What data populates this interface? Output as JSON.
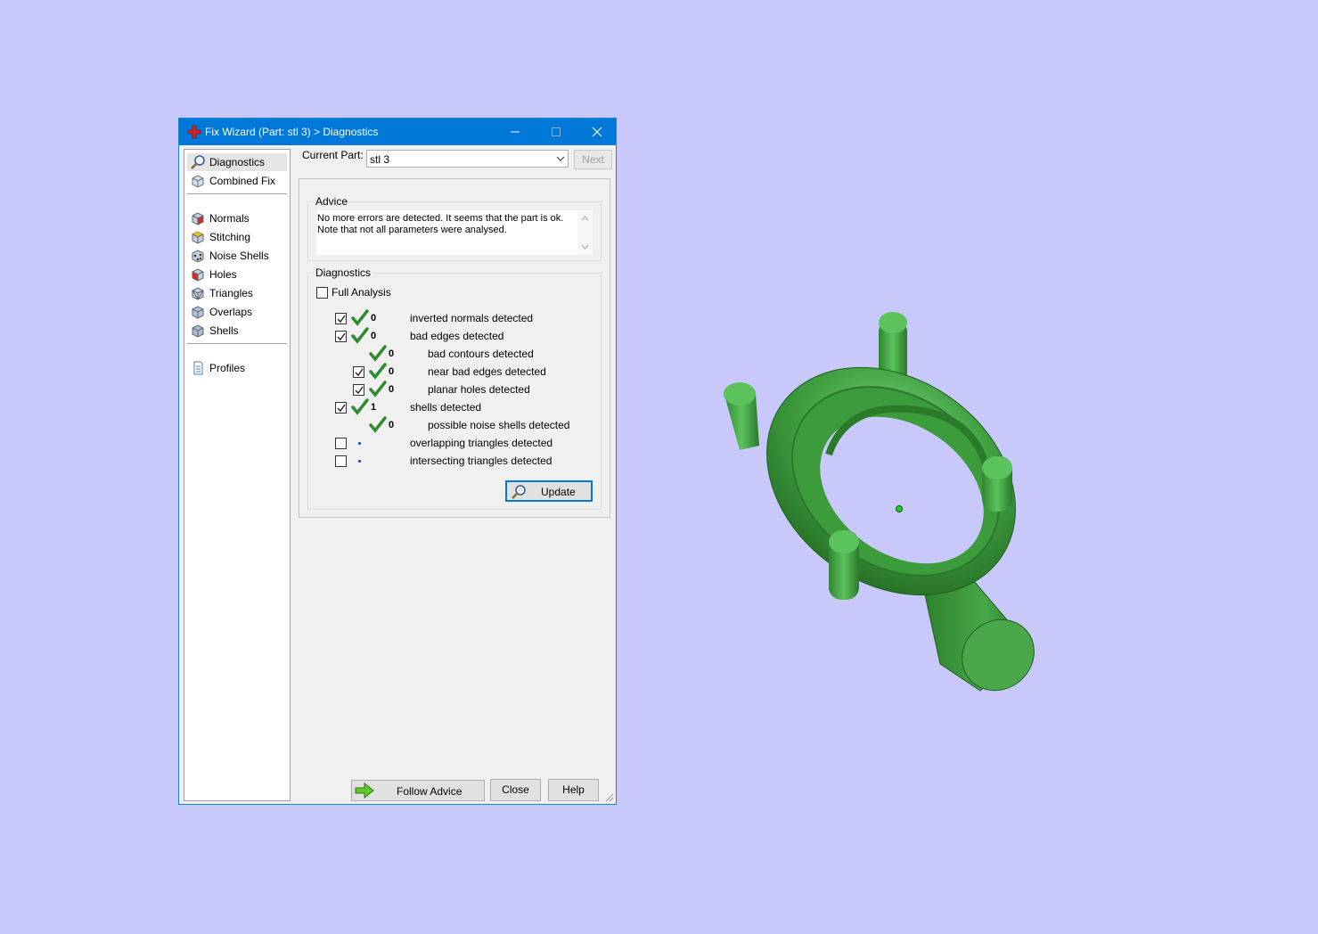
{
  "window": {
    "title": "Fix Wizard (Part: stl 3) > Diagnostics",
    "titlebar_color": "#0078d7"
  },
  "sidebar": {
    "items": [
      {
        "label": "Diagnostics",
        "icon": "magnifier-icon",
        "selected": true
      },
      {
        "label": "Combined Fix",
        "icon": "combined-fix-icon"
      },
      {
        "label": "Normals",
        "icon": "normals-cube-icon"
      },
      {
        "label": "Stitching",
        "icon": "stitching-cube-icon"
      },
      {
        "label": "Noise Shells",
        "icon": "noise-shells-icon"
      },
      {
        "label": "Holes",
        "icon": "holes-cube-icon"
      },
      {
        "label": "Triangles",
        "icon": "triangles-cube-icon"
      },
      {
        "label": "Overlaps",
        "icon": "overlaps-cube-icon"
      },
      {
        "label": "Shells",
        "icon": "shells-cube-icon"
      },
      {
        "label": "Profiles",
        "icon": "profiles-document-icon"
      }
    ]
  },
  "header": {
    "current_part_label": "Current Part:",
    "current_part_value": "stl 3",
    "next_label": "Next"
  },
  "advice": {
    "title": "Advice",
    "text": "No more errors are detected. It seems that the part is ok. Note that not all parameters were analysed."
  },
  "diagnostics": {
    "title": "Diagnostics",
    "full_analysis_label": "Full Analysis",
    "full_analysis_checked": false,
    "rows": [
      {
        "label": "inverted normals detected",
        "count": "0",
        "checked": true,
        "status": "ok",
        "level": 0
      },
      {
        "label": "bad edges detected",
        "count": "0",
        "checked": true,
        "status": "ok",
        "level": 0
      },
      {
        "label": "bad contours detected",
        "count": "0",
        "checked": null,
        "status": "ok",
        "level": 1
      },
      {
        "label": "near bad edges detected",
        "count": "0",
        "checked": true,
        "status": "ok",
        "level": 1
      },
      {
        "label": "planar holes detected",
        "count": "0",
        "checked": true,
        "status": "ok",
        "level": 1
      },
      {
        "label": "shells detected",
        "count": "1",
        "checked": true,
        "status": "ok",
        "level": 0
      },
      {
        "label": "possible noise shells detected",
        "count": "0",
        "checked": null,
        "status": "ok",
        "level": 1
      },
      {
        "label": "overlapping triangles detected",
        "count": "",
        "checked": false,
        "status": "pending",
        "level": 0
      },
      {
        "label": "intersecting triangles detected",
        "count": "",
        "checked": false,
        "status": "pending",
        "level": 0
      }
    ],
    "update_label": "Update"
  },
  "footer": {
    "follow_advice_label": "Follow Advice",
    "close_label": "Close",
    "help_label": "Help"
  },
  "colors": {
    "background": "#c8c8fa",
    "model_green": "#3a9a3a",
    "check_green": "#2e8b2e"
  }
}
